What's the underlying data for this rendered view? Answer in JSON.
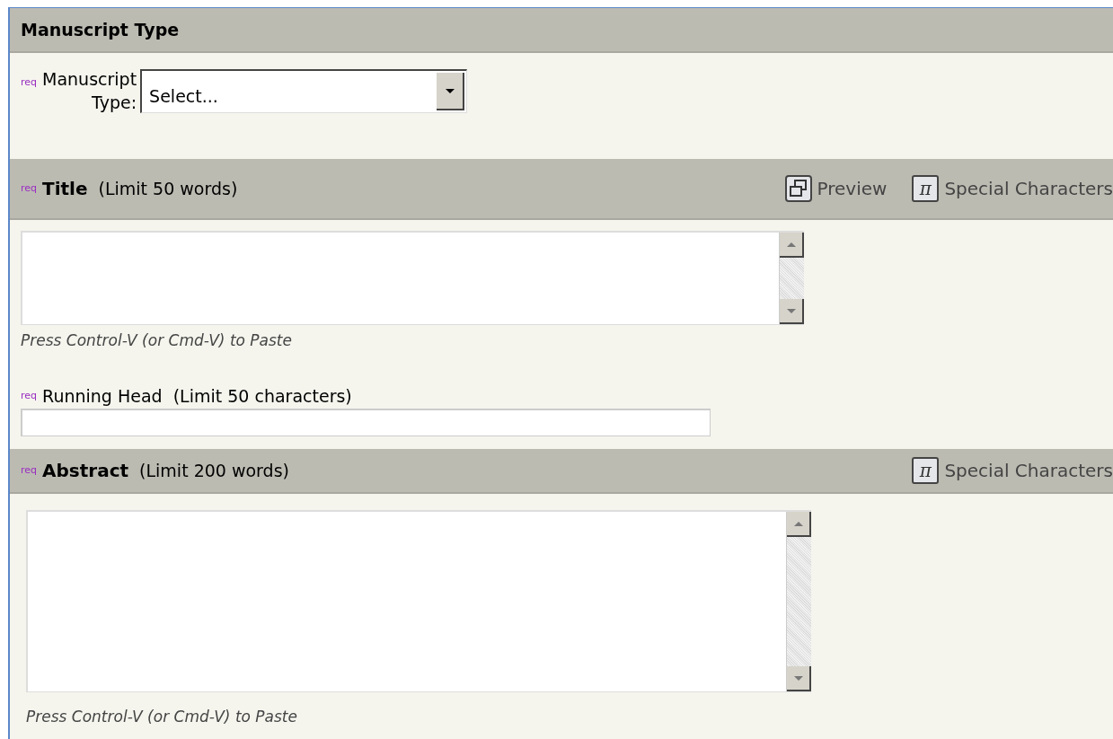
{
  "sections": [
    {
      "kind": "select",
      "header": {
        "title": "Manuscript Type"
      },
      "field": {
        "marker": "req",
        "label_lines": [
          "Manuscript",
          "Type:"
        ],
        "value": "Select..."
      }
    },
    {
      "kind": "textarea",
      "header": {
        "marker": "req",
        "title": "Title",
        "note": "(Limit 50 words)",
        "actions": [
          {
            "kind": "preview",
            "label": "Preview"
          },
          {
            "kind": "special",
            "glyph": "π",
            "label": "Special Characters"
          }
        ]
      },
      "hint": "Press Control-V (or Cmd-V) to Paste",
      "subfield": {
        "marker": "req",
        "label": "Running Head",
        "note": "(Limit 50 characters)"
      }
    },
    {
      "kind": "textarea",
      "header": {
        "marker": "req",
        "title": "Abstract",
        "note": "(Limit 200 words)",
        "actions": [
          {
            "kind": "special",
            "glyph": "π",
            "label": "Special Characters"
          }
        ]
      },
      "hint": "Press Control-V (or Cmd-V) to Paste"
    }
  ]
}
